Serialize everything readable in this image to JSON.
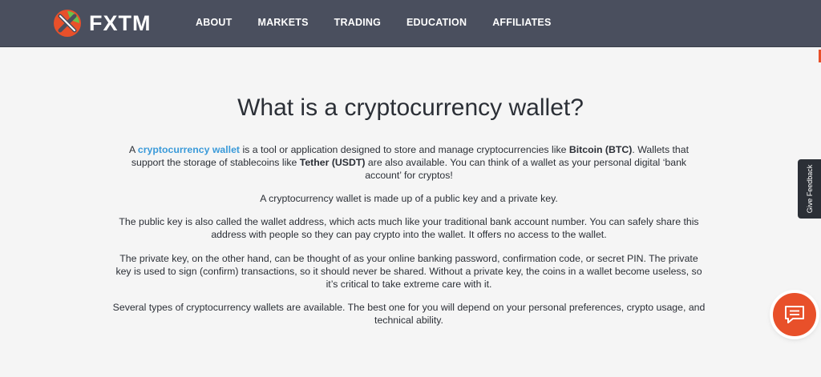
{
  "header": {
    "brand": "FXTM",
    "nav": [
      "ABOUT",
      "MARKETS",
      "TRADING",
      "EDUCATION",
      "AFFILIATES"
    ]
  },
  "main": {
    "title": "What is a cryptocurrency wallet?",
    "p1": {
      "t1": "A ",
      "link": "cryptocurrency wallet",
      "t2": " is a tool or application designed to store and manage cryptocurrencies like ",
      "b1": "Bitcoin (BTC)",
      "t3": ". Wallets that support the storage of stablecoins like ",
      "b2": "Tether (USDT)",
      "t4": " are also available. You can think of a wallet as your personal digital ‘bank account’ for cryptos!"
    },
    "p2": "A cryptocurrency wallet is made up of a public key and a private key.",
    "p3": "The public key is also called the wallet address, which acts much like your traditional bank account number. You can safely share this address with people so they can pay crypto into the wallet. It offers no access to the wallet.",
    "p4": "The private key, on the other hand, can be thought of as your online banking password, confirmation code, or secret PIN. The private key is used to sign (confirm) transactions, so it should never be shared. Without a private key, the coins in a wallet become useless, so it’s critical to take extreme care with it.",
    "p5": "Several types of cryptocurrency wallets are available. The best one for you will depend on your personal preferences, crypto usage, and technical ability."
  },
  "widgets": {
    "feedback": "Give Feedback",
    "chat_icon": "chat-bubble-icon"
  },
  "colors": {
    "header_bg": "#4a4f5e",
    "accent": "#e8502a",
    "link": "#3a9ad9",
    "page_bg": "#f5f5f5"
  }
}
